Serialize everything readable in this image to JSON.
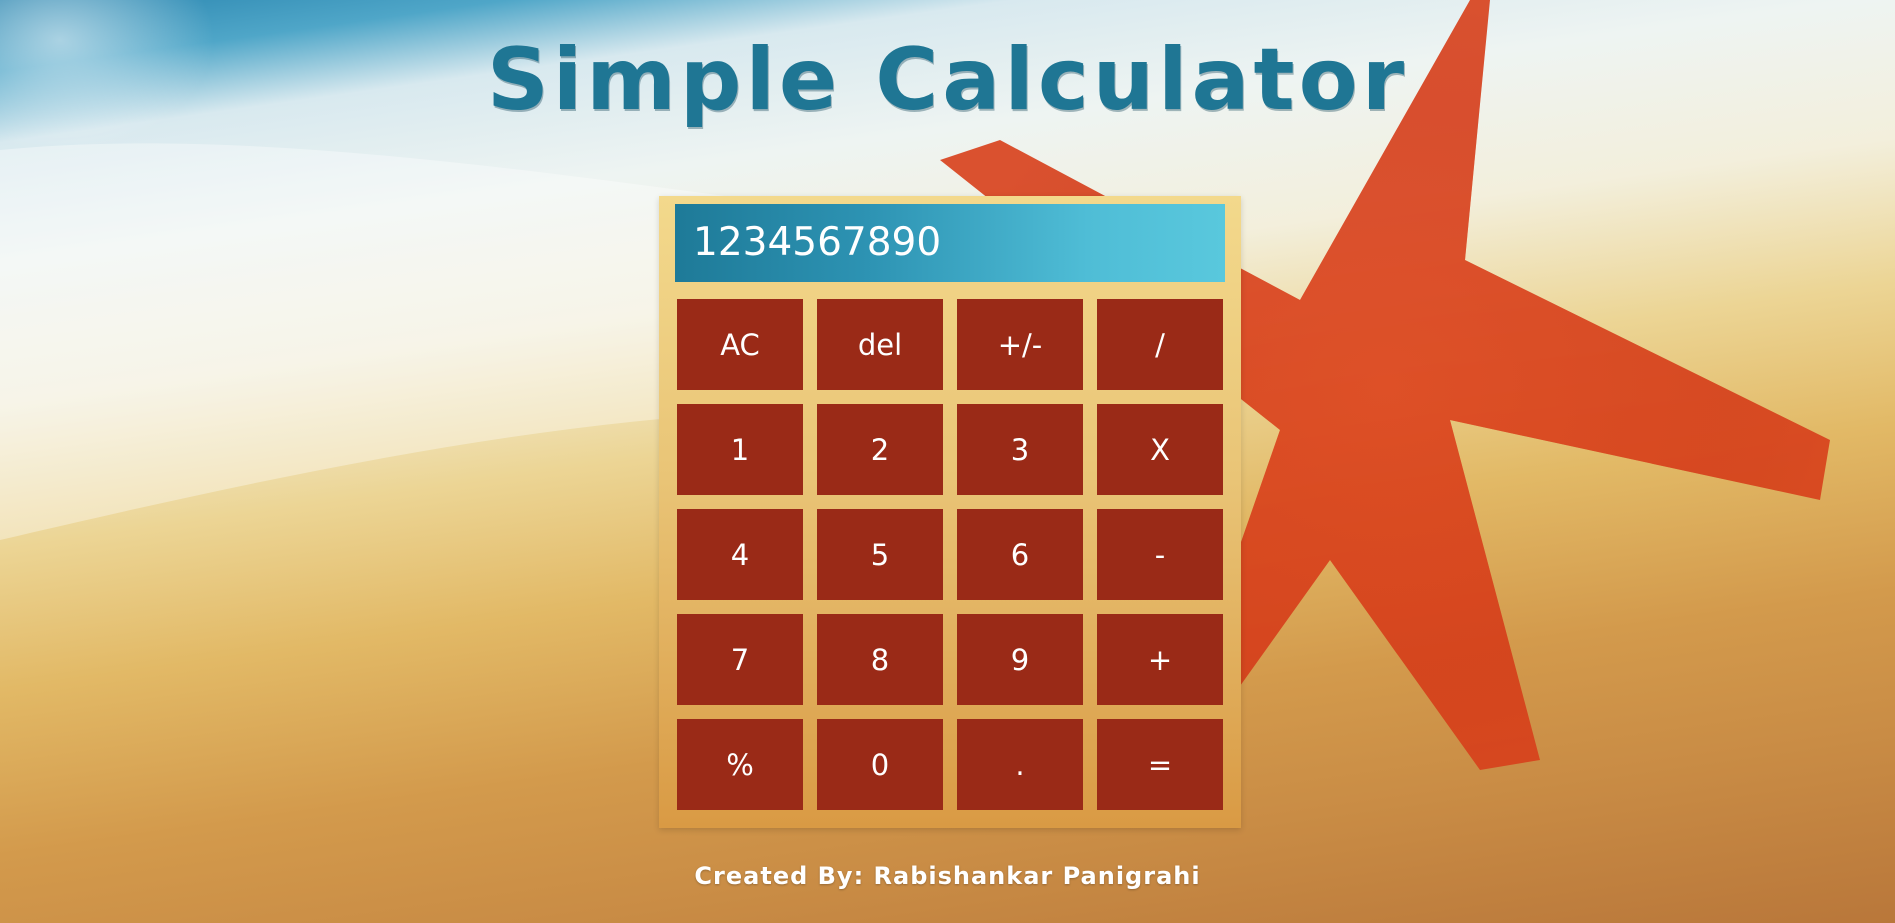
{
  "title": "Simple Calculator",
  "display": {
    "value": "1234567890"
  },
  "keys": [
    {
      "label": "AC",
      "name": "all-clear-button"
    },
    {
      "label": "del",
      "name": "delete-button"
    },
    {
      "label": "+/-",
      "name": "sign-toggle-button"
    },
    {
      "label": "/",
      "name": "divide-button"
    },
    {
      "label": "1",
      "name": "digit-1-button"
    },
    {
      "label": "2",
      "name": "digit-2-button"
    },
    {
      "label": "3",
      "name": "digit-3-button"
    },
    {
      "label": "X",
      "name": "multiply-button"
    },
    {
      "label": "4",
      "name": "digit-4-button"
    },
    {
      "label": "5",
      "name": "digit-5-button"
    },
    {
      "label": "6",
      "name": "digit-6-button"
    },
    {
      "label": "-",
      "name": "subtract-button"
    },
    {
      "label": "7",
      "name": "digit-7-button"
    },
    {
      "label": "8",
      "name": "digit-8-button"
    },
    {
      "label": "9",
      "name": "digit-9-button"
    },
    {
      "label": "+",
      "name": "add-button"
    },
    {
      "label": "%",
      "name": "percent-button"
    },
    {
      "label": "0",
      "name": "digit-0-button"
    },
    {
      "label": ".",
      "name": "decimal-button"
    },
    {
      "label": "=",
      "name": "equals-button"
    }
  ],
  "footer": {
    "credit": "Created By: Rabishankar Panigrahi"
  },
  "colors": {
    "title": "#1f7694",
    "key_background": "#9a2a17",
    "display_gradient_start": "#1e7a98",
    "display_gradient_end": "#59c8dd",
    "frame_top": "#f3d98c",
    "frame_bottom": "#d99a44"
  }
}
